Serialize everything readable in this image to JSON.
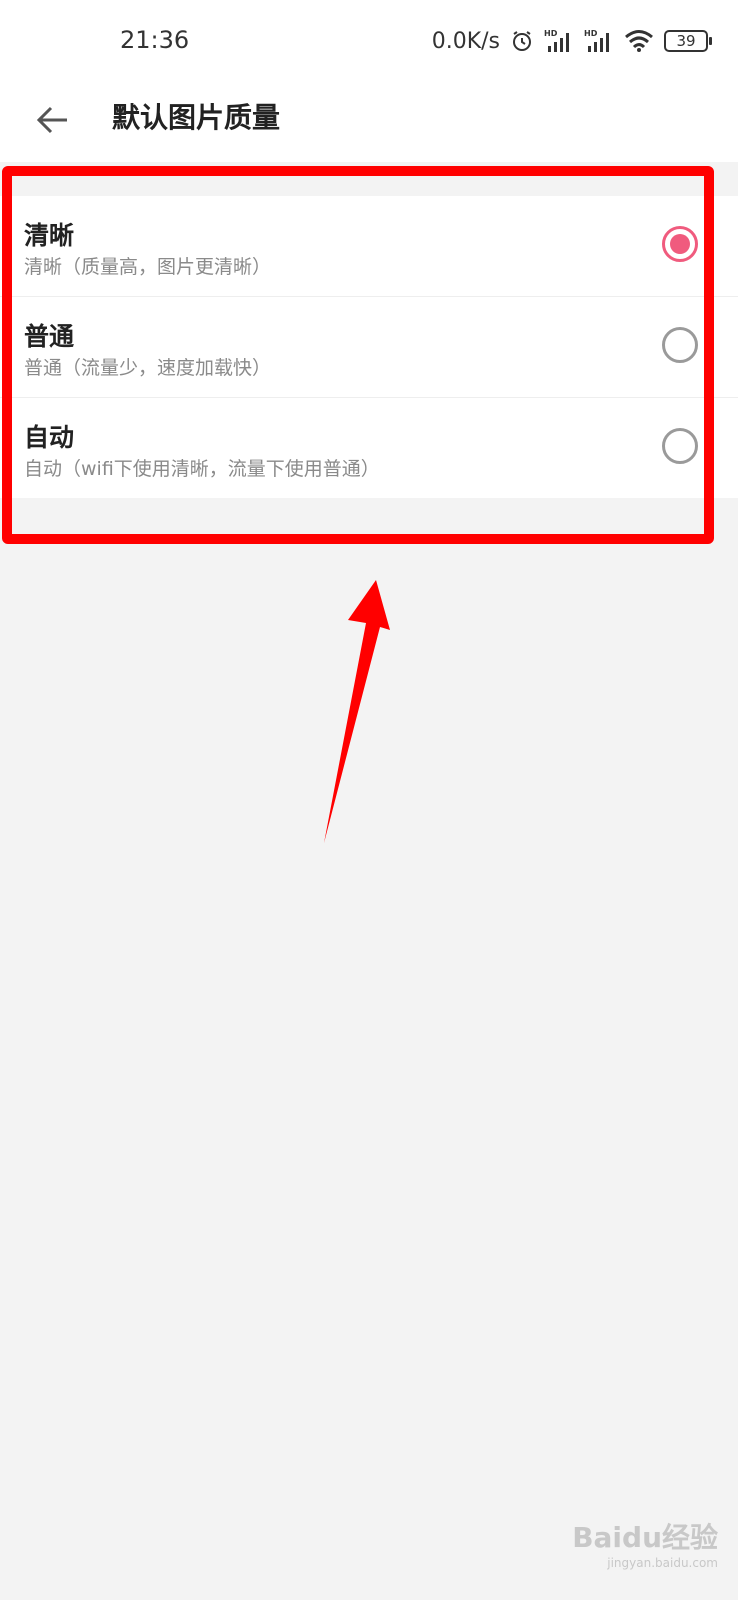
{
  "status": {
    "time": "21:36",
    "net_speed": "0.0K/s",
    "battery": "39",
    "icons": [
      "alarm-icon",
      "signal-hd-icon",
      "signal-hd-icon",
      "wifi-icon",
      "battery-icon"
    ]
  },
  "header": {
    "title": "默认图片质量",
    "back_icon": "arrow-left-icon"
  },
  "options": [
    {
      "title": "清晰",
      "subtitle": "清晰（质量高，图片更清晰）",
      "selected": true
    },
    {
      "title": "普通",
      "subtitle": "普通（流量少，速度加载快）",
      "selected": false
    },
    {
      "title": "自动",
      "subtitle": "自动（wifi下使用清晰，流量下使用普通）",
      "selected": false
    }
  ],
  "colors": {
    "accent": "#f05b7e",
    "annotation": "#ff0000",
    "background": "#f3f3f3"
  },
  "watermark": {
    "logo": "Baidu经验",
    "sub": "jingyan.baidu.com"
  }
}
